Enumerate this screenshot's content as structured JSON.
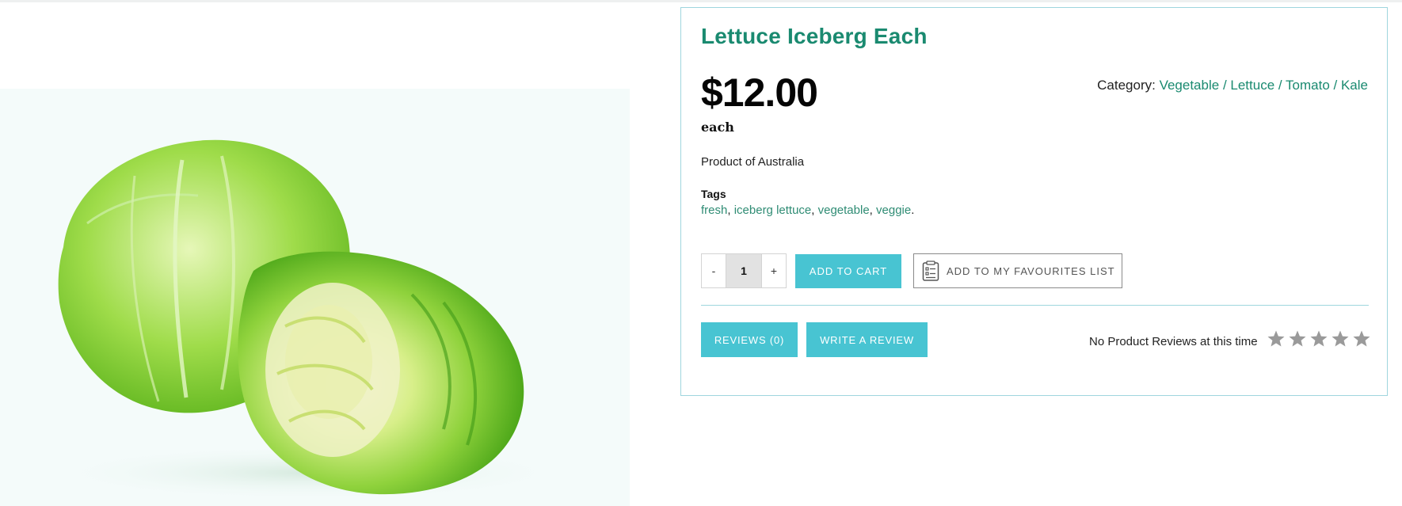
{
  "product": {
    "title": "Lettuce Iceberg Each",
    "price": "$12.00",
    "unit": "each",
    "origin": "Product of Australia",
    "image_icon": "iceberg-lettuce-photo"
  },
  "category": {
    "label": "Category:",
    "items": [
      "Vegetable",
      "Lettuce",
      "Tomato",
      "Kale"
    ],
    "separator": "/"
  },
  "tags": {
    "label": "Tags",
    "items": [
      "fresh",
      "iceberg lettuce",
      "vegetable",
      "veggie"
    ],
    "comma": ",",
    "end": "."
  },
  "cart": {
    "decrement_label": "-",
    "quantity": "1",
    "increment_label": "+",
    "add_to_cart_label": "ADD TO CART",
    "favourites_label": "ADD TO MY FAVOURITES LIST",
    "favourites_icon": "checklist-icon"
  },
  "reviews": {
    "reviews_button_label": "REVIEWS (0)",
    "write_review_label": "WRITE A REVIEW",
    "status_text": "No Product Reviews at this time",
    "rating": 0,
    "max_rating": 5
  },
  "colors": {
    "accent_button": "#48c4d2",
    "link_green": "#1a8a70",
    "card_border": "#9fd6de",
    "star_empty": "#9a9a9a"
  }
}
